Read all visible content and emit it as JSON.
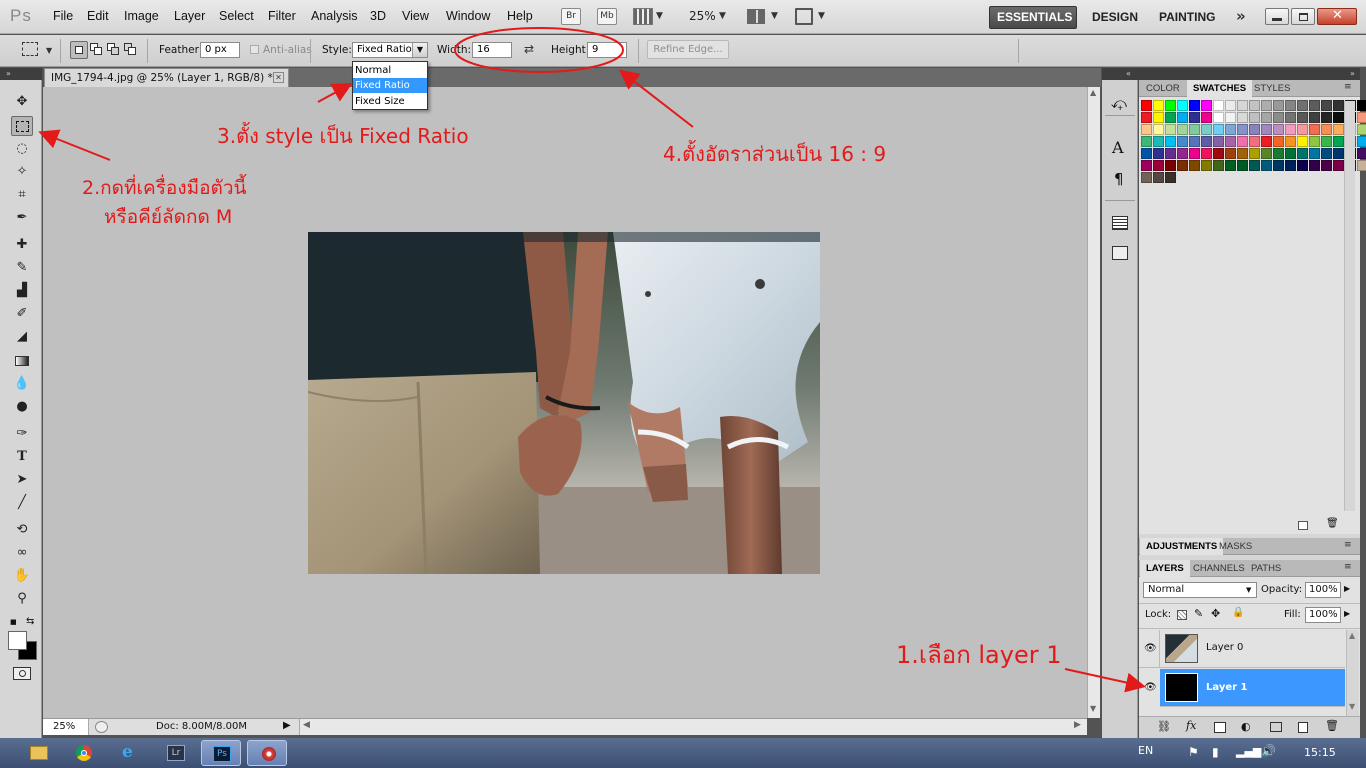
{
  "app": {
    "logo": "Ps"
  },
  "menu": [
    "File",
    "Edit",
    "Image",
    "Layer",
    "Select",
    "Filter",
    "Analysis",
    "3D",
    "View",
    "Window",
    "Help"
  ],
  "appbar": {
    "bridge": "Br",
    "minibridge": "Mb",
    "zoom": "25%"
  },
  "workspaces": [
    "ESSENTIALS",
    "DESIGN",
    "PAINTING"
  ],
  "options": {
    "feather_label": "Feather:",
    "feather_value": "0 px",
    "antialias_label": "Anti-alias",
    "style_label": "Style:",
    "style_value": "Fixed Ratio",
    "width_label": "Width:",
    "width_value": "16",
    "height_label": "Height:",
    "height_value": "9",
    "refine_edge": "Refine Edge..."
  },
  "style_dropdown": {
    "options": [
      "Normal",
      "Fixed Ratio",
      "Fixed Size"
    ],
    "selected": "Fixed Ratio"
  },
  "document": {
    "tab_title": "IMG_1794-4.jpg @ 25% (Layer 1, RGB/8) *",
    "zoom": "25%",
    "doc_info": "Doc: 8.00M/8.00M"
  },
  "panels": {
    "color_tabs": [
      "COLOR",
      "SWATCHES",
      "STYLES"
    ],
    "active_color_tab": "SWATCHES",
    "adjust_tabs": [
      "ADJUSTMENTS",
      "MASKS"
    ],
    "layer_tabs": [
      "LAYERS",
      "CHANNELS",
      "PATHS"
    ],
    "blend_mode": "Normal",
    "opacity_label": "Opacity:",
    "opacity_value": "100%",
    "lock_label": "Lock:",
    "fill_label": "Fill:",
    "fill_value": "100%",
    "layers": [
      {
        "name": "Layer 0",
        "selected": false
      },
      {
        "name": "Layer 1",
        "selected": true
      }
    ],
    "swatch_rows": [
      [
        "#ff0000",
        "#ffff00",
        "#00ff00",
        "#00ffff",
        "#0000ff",
        "#ff00ff",
        "#ffffff",
        "#ebebeb",
        "#d6d6d6",
        "#c2c2c2",
        "#adadad",
        "#999999",
        "#858585",
        "#707070",
        "#5c5c5c",
        "#474747",
        "#333333",
        "#1f1f1f",
        "#000000",
        "#ee1c24"
      ],
      [
        "#ed1c24",
        "#fff200",
        "#00a651",
        "#00aeef",
        "#2e3192",
        "#ec008c",
        "#ffffff",
        "#f2f2f2",
        "#d9d9d9",
        "#bfbfbf",
        "#a6a6a6",
        "#8c8c8c",
        "#737373",
        "#595959",
        "#404040",
        "#262626",
        "#0d0d0d",
        "#000000",
        "#f7977a",
        "#f9ad81"
      ],
      [
        "#fdc68a",
        "#fff79a",
        "#c4df9b",
        "#a2d39c",
        "#82ca9d",
        "#7bcdc8",
        "#6ecff6",
        "#7ea7d8",
        "#8493ca",
        "#8882be",
        "#a187be",
        "#bc8dbf",
        "#f49ac2",
        "#f6989d",
        "#f26c4f",
        "#f68e55",
        "#fbaf5c",
        "#fff467",
        "#acd372",
        "#7cc576"
      ],
      [
        "#3bb878",
        "#1abbb4",
        "#00bff3",
        "#438ccb",
        "#5574b9",
        "#605ca8",
        "#855fa8",
        "#a763a8",
        "#f06eaa",
        "#f26d7d",
        "#ed1c24",
        "#f26522",
        "#f7941d",
        "#fff200",
        "#8dc73f",
        "#39b54a",
        "#00a651",
        "#00a99d",
        "#00aeef",
        "#0072bc"
      ],
      [
        "#0054a6",
        "#2e3192",
        "#662d91",
        "#92278f",
        "#ec008c",
        "#ed145b",
        "#9e0b0f",
        "#a0410d",
        "#a3620a",
        "#aba000",
        "#598527",
        "#197b30",
        "#007236",
        "#00746b",
        "#0076a3",
        "#004b80",
        "#003471",
        "#1b1464",
        "#440e62",
        "#630460"
      ],
      [
        "#9e005d",
        "#9e0039",
        "#790000",
        "#7b2e00",
        "#7d4900",
        "#827b00",
        "#406618",
        "#005e20",
        "#005826",
        "#005952",
        "#005b7f",
        "#003663",
        "#002157",
        "#0d004c",
        "#32004b",
        "#4b0049",
        "#7b0046",
        "#7a0026",
        "#c7b299",
        "#998675"
      ],
      [
        "#736357",
        "#534741",
        "#37302a"
      ]
    ]
  },
  "taskbar": {
    "lang": "EN",
    "time": "15:15"
  },
  "annotations": {
    "step1": "1.เลือก layer 1",
    "step2_line1": "2.กดที่เครื่องมือตัวนี้",
    "step2_line2": "หรือคีย์ลัดกด M",
    "step3": "3.ตั้ง style เป็น Fixed Ratio",
    "step4": "4.ตั้งอัตราส่วนเป็น 16 : 9"
  }
}
